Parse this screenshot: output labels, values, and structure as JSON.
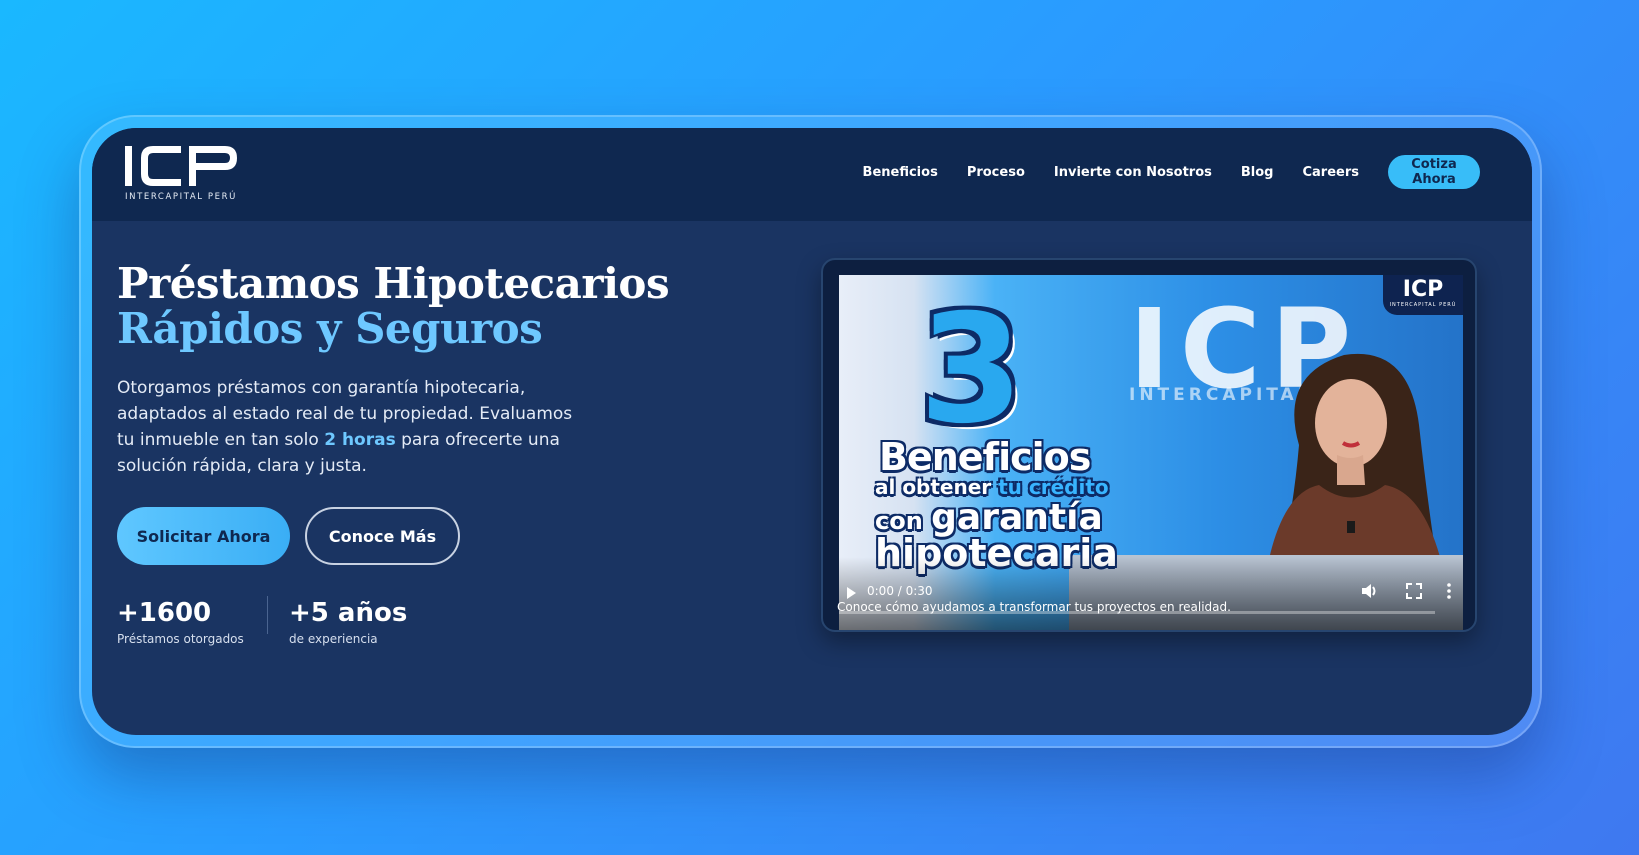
{
  "brand": {
    "logo_text": "ICP",
    "logo_subtitle": "INTERCAPITAL PERÚ"
  },
  "nav": {
    "items": [
      "Beneficios",
      "Proceso",
      "Invierte con Nosotros",
      "Blog",
      "Careers"
    ],
    "cta_label": "Cotiza Ahora"
  },
  "hero": {
    "title_line1": "Préstamos Hipotecarios",
    "title_line2": "Rápidos y Seguros",
    "desc_part1": "Otorgamos préstamos con garantía hipotecaria, adaptados al estado real de tu propiedad. Evaluamos tu inmueble en tan solo ",
    "desc_highlight": "2 horas",
    "desc_part2": " para ofrecerte una solución rápida, clara y justa.",
    "primary_button": "Solicitar Ahora",
    "secondary_button": "Conoce Más"
  },
  "stats": [
    {
      "value": "+1600",
      "label": "Préstamos otorgados"
    },
    {
      "value": "+5 años",
      "label": "de experiencia"
    }
  ],
  "video": {
    "thumbnail_number": "3",
    "thumbnail_line1": "Beneficios",
    "thumbnail_line2a": "al obtener ",
    "thumbnail_line2b": "tu crédito",
    "thumbnail_line3a": "con ",
    "thumbnail_line3b": "garantía",
    "thumbnail_line4": "hipotecaria",
    "wall_logo": "ICP",
    "wall_sub": "INTERCAPITAL PERÚ",
    "badge_logo": "ICP",
    "badge_sub": "INTERCAPITAL PERÚ",
    "time": "0:00 / 0:30",
    "progress": 0,
    "caption": "Conoce cómo ayudamos a transformar tus proyectos en realidad."
  },
  "colors": {
    "page_bg_start": "#1ab8ff",
    "page_bg_end": "#3f78f0",
    "site_bg": "#1a3462",
    "navbar_bg": "#0f2850",
    "accent": "#6ec8ff",
    "cta_bg": "#38bdf8"
  },
  "icons": [
    "play-icon",
    "volume-icon",
    "fullscreen-icon",
    "more-options-icon"
  ]
}
